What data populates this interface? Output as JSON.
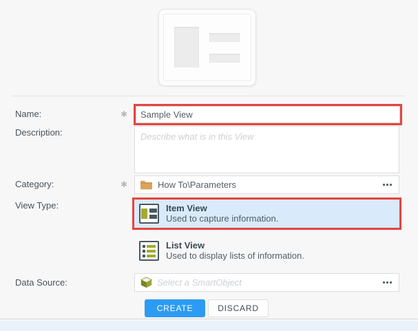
{
  "colors": {
    "accent_red": "#e5443f",
    "selection_blue": "#d9eafa",
    "create_blue": "#2d9bf3",
    "icon_slate": "#47575f",
    "icon_olive": "#a4aa2e",
    "folder_tan": "#d9a45c",
    "page_bg": "#f7f7f7"
  },
  "icons": {
    "required_marker": "✱"
  },
  "form": {
    "name": {
      "label": "Name:",
      "value": "Sample View"
    },
    "description": {
      "label": "Description:",
      "placeholder": "Describe what is in this View"
    },
    "category": {
      "label": "Category:",
      "value": "How To\\Parameters"
    },
    "view_type": {
      "label": "View Type:",
      "options": [
        {
          "title": "Item View",
          "description": "Used to capture information."
        },
        {
          "title": "List View",
          "description": "Used to display lists of information."
        }
      ]
    },
    "data_source": {
      "label": "Data Source:",
      "placeholder": "Select a SmartObject"
    },
    "actions": {
      "create": "CREATE",
      "discard": "DISCARD"
    }
  }
}
